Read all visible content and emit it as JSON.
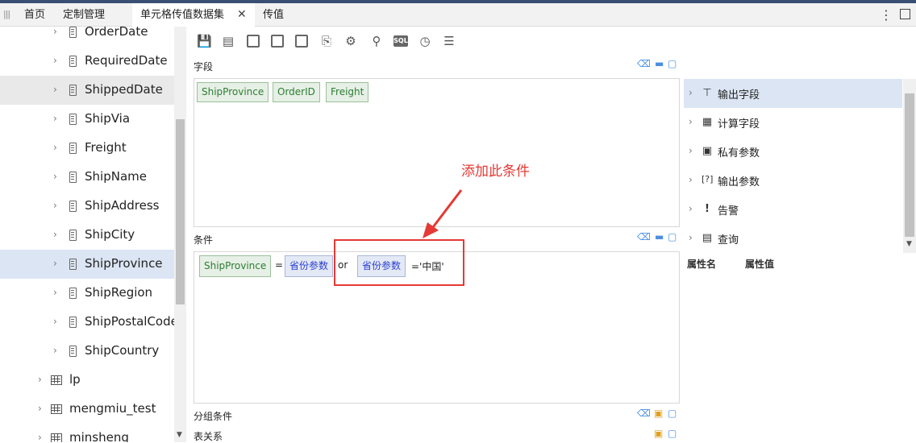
{
  "tabs": [
    {
      "label": "首页"
    },
    {
      "label": "定制管理"
    },
    {
      "label": "单元格传值数据集",
      "closable": true,
      "active": true
    },
    {
      "label": "传值"
    }
  ],
  "tree": [
    {
      "label": "OrderDate",
      "type": "field"
    },
    {
      "label": "RequiredDate",
      "type": "field"
    },
    {
      "label": "ShippedDate",
      "type": "field",
      "highlight": "gray"
    },
    {
      "label": "ShipVia",
      "type": "field"
    },
    {
      "label": "Freight",
      "type": "field"
    },
    {
      "label": "ShipName",
      "type": "field"
    },
    {
      "label": "ShipAddress",
      "type": "field"
    },
    {
      "label": "ShipCity",
      "type": "field"
    },
    {
      "label": "ShipProvince",
      "type": "field",
      "highlight": "blue"
    },
    {
      "label": "ShipRegion",
      "type": "field"
    },
    {
      "label": "ShipPostalCode",
      "type": "field"
    },
    {
      "label": "ShipCountry",
      "type": "field"
    },
    {
      "label": "lp",
      "type": "table"
    },
    {
      "label": "mengmiu_test",
      "type": "table"
    },
    {
      "label": "minsheng",
      "type": "table"
    }
  ],
  "sections": {
    "fields_title": "字段",
    "conditions_title": "条件",
    "group_title": "分组条件",
    "relation_title": "表关系"
  },
  "field_chips": [
    "ShipProvince",
    "OrderID",
    "Freight"
  ],
  "condition": {
    "field": "ShipProvince",
    "op1": "=",
    "param1": "省份参数",
    "logic": "or",
    "param2": "省份参数",
    "tail": "='中国'"
  },
  "annotation": "添加此条件",
  "right_items": [
    {
      "label": "输出字段",
      "icon": "output-field-icon",
      "glyph": "⊤",
      "selected": true
    },
    {
      "label": "计算字段",
      "icon": "calculator-icon",
      "glyph": "▦"
    },
    {
      "label": "私有参数",
      "icon": "private-param-icon",
      "glyph": "▣"
    },
    {
      "label": "输出参数",
      "icon": "output-param-icon",
      "glyph": "[?]"
    },
    {
      "label": "告警",
      "icon": "alert-icon",
      "glyph": "!"
    },
    {
      "label": "查询",
      "icon": "query-icon",
      "glyph": "▤"
    }
  ],
  "props": {
    "name": "属性名",
    "value": "属性值"
  },
  "colors": {
    "accent": "#e53935",
    "chip_green": "#2e7d32",
    "chip_blue": "#2a3fd0",
    "selection": "#dbe5f3"
  }
}
